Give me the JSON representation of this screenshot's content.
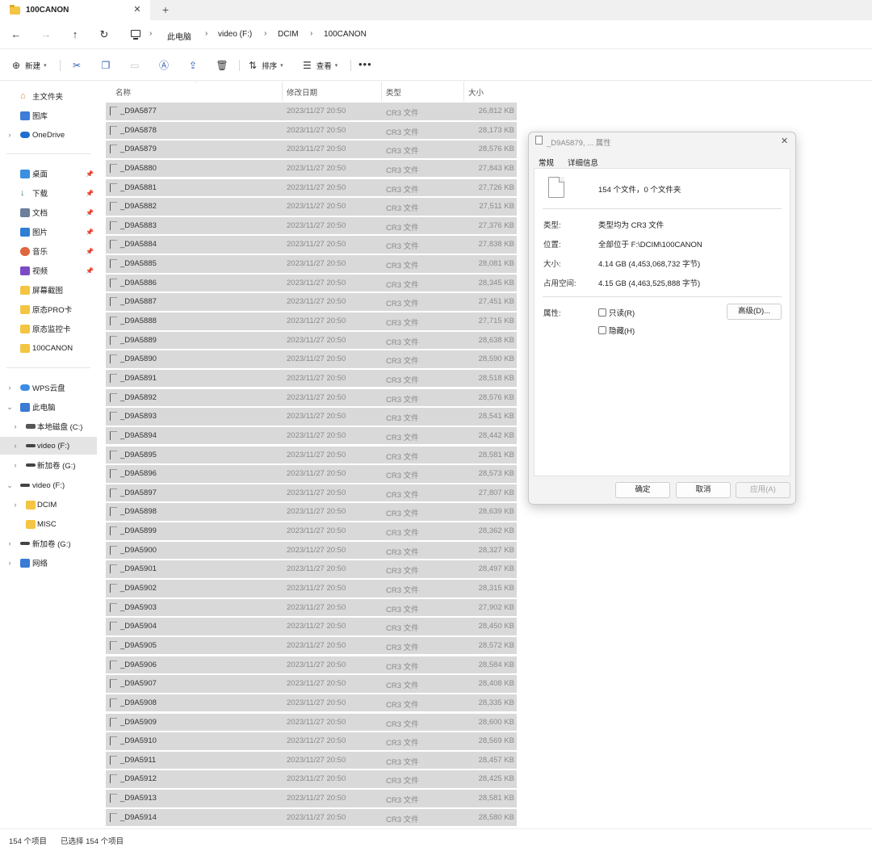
{
  "tab": {
    "title": "100CANON",
    "close_glyph": "✕",
    "new_glyph": "+"
  },
  "address": {
    "crumbs": [
      "此电脑",
      "video (F:)",
      "DCIM",
      "100CANON"
    ],
    "sep": "›"
  },
  "toolbar": {
    "new_label": "新建",
    "sort_label": "排序",
    "view_label": "查看",
    "more_label": "•••"
  },
  "sidebar": {
    "home": "主文件夹",
    "gallery": "图库",
    "onedrive": "OneDrive",
    "desktop": "桌面",
    "downloads": "下载",
    "documents": "文档",
    "pictures": "图片",
    "music": "音乐",
    "videos": "视频",
    "screenshots": "屏幕截图",
    "tf_pro": "原态PRO卡",
    "tf_monitor": "原态监控卡",
    "canon": "100CANON",
    "wps": "WPS云盘",
    "thispc": "此电脑",
    "drive_c": "本地磁盘 (C:)",
    "drive_f": "video (F:)",
    "drive_g": "新加卷 (G:)",
    "video_f": "video (F:)",
    "dcim": "DCIM",
    "misc": "MISC",
    "new_g": "新加卷 (G:)",
    "network": "网络"
  },
  "columns": {
    "name": "名称",
    "date": "修改日期",
    "type": "类型",
    "size": "大小"
  },
  "files": [
    {
      "name": "_D9A5877",
      "date": "2023/11/27 20:50",
      "type": "CR3 文件",
      "size": "26,812 KB"
    },
    {
      "name": "_D9A5878",
      "date": "2023/11/27 20:50",
      "type": "CR3 文件",
      "size": "28,173 KB"
    },
    {
      "name": "_D9A5879",
      "date": "2023/11/27 20:50",
      "type": "CR3 文件",
      "size": "28,576 KB"
    },
    {
      "name": "_D9A5880",
      "date": "2023/11/27 20:50",
      "type": "CR3 文件",
      "size": "27,843 KB"
    },
    {
      "name": "_D9A5881",
      "date": "2023/11/27 20:50",
      "type": "CR3 文件",
      "size": "27,726 KB"
    },
    {
      "name": "_D9A5882",
      "date": "2023/11/27 20:50",
      "type": "CR3 文件",
      "size": "27,511 KB"
    },
    {
      "name": "_D9A5883",
      "date": "2023/11/27 20:50",
      "type": "CR3 文件",
      "size": "27,376 KB"
    },
    {
      "name": "_D9A5884",
      "date": "2023/11/27 20:50",
      "type": "CR3 文件",
      "size": "27,838 KB"
    },
    {
      "name": "_D9A5885",
      "date": "2023/11/27 20:50",
      "type": "CR3 文件",
      "size": "28,081 KB"
    },
    {
      "name": "_D9A5886",
      "date": "2023/11/27 20:50",
      "type": "CR3 文件",
      "size": "28,345 KB"
    },
    {
      "name": "_D9A5887",
      "date": "2023/11/27 20:50",
      "type": "CR3 文件",
      "size": "27,451 KB"
    },
    {
      "name": "_D9A5888",
      "date": "2023/11/27 20:50",
      "type": "CR3 文件",
      "size": "27,715 KB"
    },
    {
      "name": "_D9A5889",
      "date": "2023/11/27 20:50",
      "type": "CR3 文件",
      "size": "28,638 KB"
    },
    {
      "name": "_D9A5890",
      "date": "2023/11/27 20:50",
      "type": "CR3 文件",
      "size": "28,590 KB"
    },
    {
      "name": "_D9A5891",
      "date": "2023/11/27 20:50",
      "type": "CR3 文件",
      "size": "28,518 KB"
    },
    {
      "name": "_D9A5892",
      "date": "2023/11/27 20:50",
      "type": "CR3 文件",
      "size": "28,576 KB"
    },
    {
      "name": "_D9A5893",
      "date": "2023/11/27 20:50",
      "type": "CR3 文件",
      "size": "28,541 KB"
    },
    {
      "name": "_D9A5894",
      "date": "2023/11/27 20:50",
      "type": "CR3 文件",
      "size": "28,442 KB"
    },
    {
      "name": "_D9A5895",
      "date": "2023/11/27 20:50",
      "type": "CR3 文件",
      "size": "28,581 KB"
    },
    {
      "name": "_D9A5896",
      "date": "2023/11/27 20:50",
      "type": "CR3 文件",
      "size": "28,573 KB"
    },
    {
      "name": "_D9A5897",
      "date": "2023/11/27 20:50",
      "type": "CR3 文件",
      "size": "27,807 KB"
    },
    {
      "name": "_D9A5898",
      "date": "2023/11/27 20:50",
      "type": "CR3 文件",
      "size": "28,639 KB"
    },
    {
      "name": "_D9A5899",
      "date": "2023/11/27 20:50",
      "type": "CR3 文件",
      "size": "28,362 KB"
    },
    {
      "name": "_D9A5900",
      "date": "2023/11/27 20:50",
      "type": "CR3 文件",
      "size": "28,327 KB"
    },
    {
      "name": "_D9A5901",
      "date": "2023/11/27 20:50",
      "type": "CR3 文件",
      "size": "28,497 KB"
    },
    {
      "name": "_D9A5902",
      "date": "2023/11/27 20:50",
      "type": "CR3 文件",
      "size": "28,315 KB"
    },
    {
      "name": "_D9A5903",
      "date": "2023/11/27 20:50",
      "type": "CR3 文件",
      "size": "27,902 KB"
    },
    {
      "name": "_D9A5904",
      "date": "2023/11/27 20:50",
      "type": "CR3 文件",
      "size": "28,450 KB"
    },
    {
      "name": "_D9A5905",
      "date": "2023/11/27 20:50",
      "type": "CR3 文件",
      "size": "28,572 KB"
    },
    {
      "name": "_D9A5906",
      "date": "2023/11/27 20:50",
      "type": "CR3 文件",
      "size": "28,584 KB"
    },
    {
      "name": "_D9A5907",
      "date": "2023/11/27 20:50",
      "type": "CR3 文件",
      "size": "28,408 KB"
    },
    {
      "name": "_D9A5908",
      "date": "2023/11/27 20:50",
      "type": "CR3 文件",
      "size": "28,335 KB"
    },
    {
      "name": "_D9A5909",
      "date": "2023/11/27 20:50",
      "type": "CR3 文件",
      "size": "28,600 KB"
    },
    {
      "name": "_D9A5910",
      "date": "2023/11/27 20:50",
      "type": "CR3 文件",
      "size": "28,569 KB"
    },
    {
      "name": "_D9A5911",
      "date": "2023/11/27 20:50",
      "type": "CR3 文件",
      "size": "28,457 KB"
    },
    {
      "name": "_D9A5912",
      "date": "2023/11/27 20:50",
      "type": "CR3 文件",
      "size": "28,425 KB"
    },
    {
      "name": "_D9A5913",
      "date": "2023/11/27 20:50",
      "type": "CR3 文件",
      "size": "28,581 KB"
    },
    {
      "name": "_D9A5914",
      "date": "2023/11/27 20:50",
      "type": "CR3 文件",
      "size": "28,580 KB"
    }
  ],
  "status": {
    "count": "154 个项目",
    "selected": "已选择 154 个项目"
  },
  "dialog": {
    "title": "_D9A5879, ... 属性",
    "tab_general": "常规",
    "tab_details": "详细信息",
    "summary": "154 个文件，0 个文件夹",
    "type_label": "类型:",
    "type_value": "类型均为 CR3 文件",
    "location_label": "位置:",
    "location_value": "全部位于 F:\\DCIM\\100CANON",
    "size_label": "大小:",
    "size_value": "4.14 GB (4,453,068,732 字节)",
    "disk_label": "占用空间:",
    "disk_value": "4.15 GB (4,463,525,888 字节)",
    "attr_label": "属性:",
    "readonly_label": "只读(R)",
    "hidden_label": "隐藏(H)",
    "advanced_label": "高级(D)...",
    "ok_label": "确定",
    "cancel_label": "取消",
    "apply_label": "应用(A)"
  },
  "colors": {
    "accent": "#2f5fb3",
    "selection": "#d9d9d9",
    "folder": "#f4c542"
  }
}
